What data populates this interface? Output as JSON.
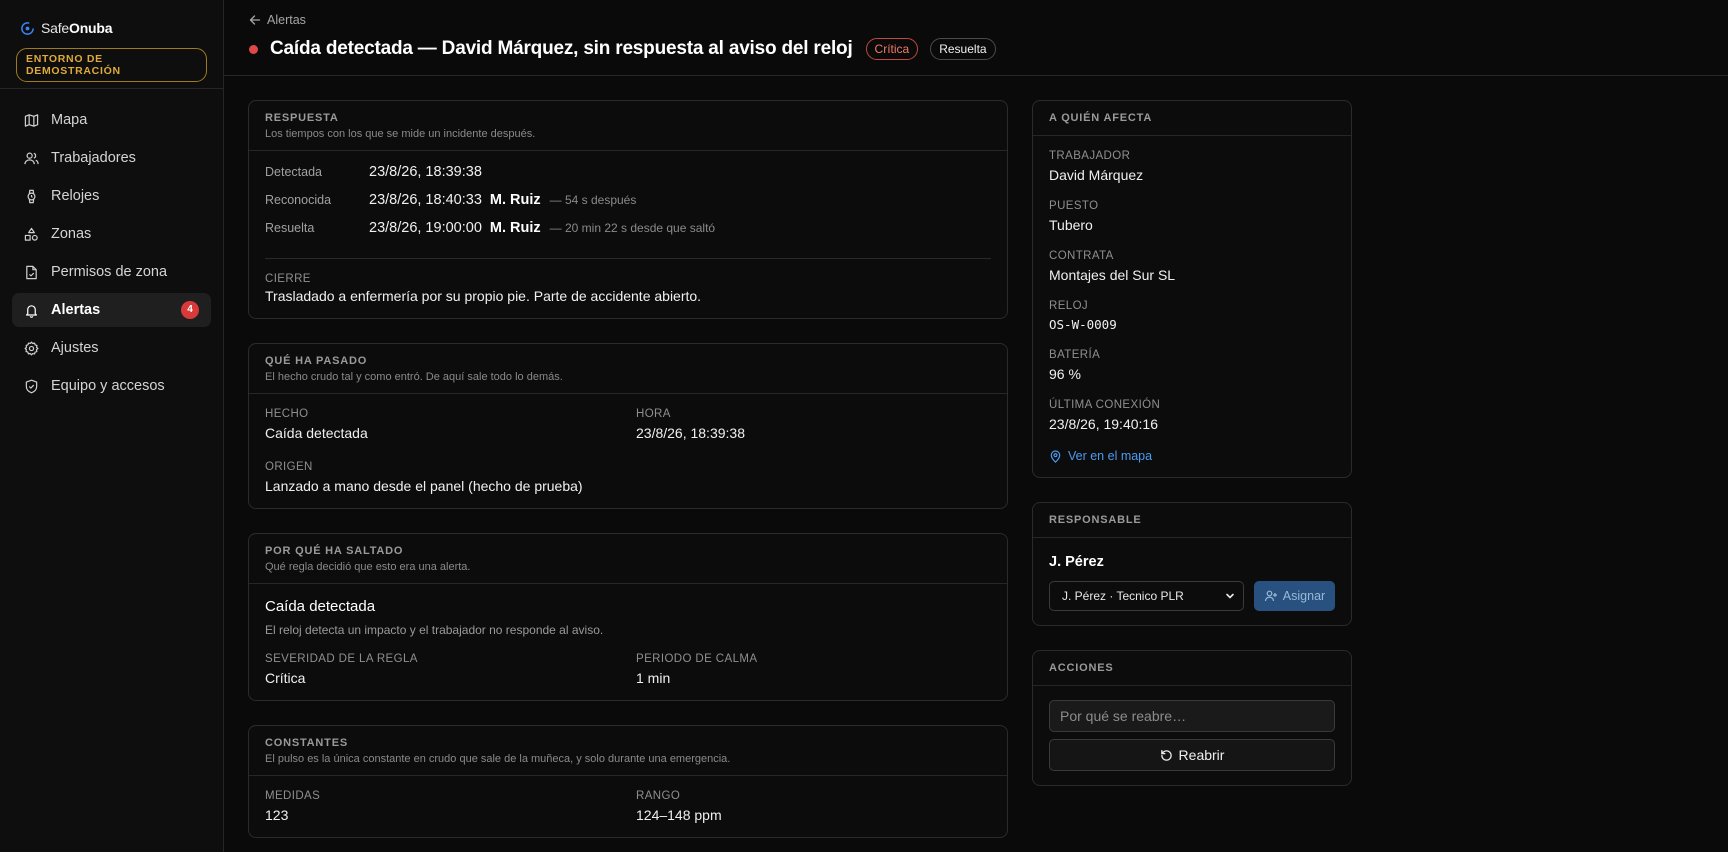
{
  "brand": {
    "name_light": "Safe",
    "name_bold": "Onuba",
    "env_badge": "ENTORNO DE DEMOSTRACIÓN",
    "accent": "#e0a93a"
  },
  "sidebar": {
    "items": [
      {
        "label": "Mapa",
        "icon": "map-icon"
      },
      {
        "label": "Trabajadores",
        "icon": "users-icon"
      },
      {
        "label": "Relojes",
        "icon": "watch-icon"
      },
      {
        "label": "Zonas",
        "icon": "shapes-icon"
      },
      {
        "label": "Permisos de zona",
        "icon": "file-check-icon"
      },
      {
        "label": "Alertas",
        "icon": "bell-icon",
        "badge": "4",
        "active": true
      },
      {
        "label": "Ajustes",
        "icon": "gear-icon"
      },
      {
        "label": "Equipo y accesos",
        "icon": "shield-check-icon"
      }
    ]
  },
  "header": {
    "back_label": "Alertas",
    "title": "Caída detectada — David Márquez, sin respuesta al aviso del reloj",
    "severity_pill": "Crítica",
    "status_pill": "Resuelta",
    "severity_color": "#e04848"
  },
  "respuesta": {
    "title": "RESPUESTA",
    "subtitle": "Los tiempos con los que se mide un incidente después.",
    "rows": [
      {
        "label": "Detectada",
        "time": "23/8/26, 18:39:38",
        "who": "",
        "note": ""
      },
      {
        "label": "Reconocida",
        "time": "23/8/26, 18:40:33",
        "who": "M. Ruiz",
        "note": "— 54 s después"
      },
      {
        "label": "Resuelta",
        "time": "23/8/26, 19:00:00",
        "who": "M. Ruiz",
        "note": "— 20 min 22 s desde que saltó"
      }
    ],
    "cierre_label": "CIERRE",
    "cierre_text": "Trasladado a enfermería por su propio pie. Parte de accidente abierto."
  },
  "que_ha_pasado": {
    "title": "QUÉ HA PASADO",
    "subtitle": "El hecho crudo tal y como entró. De aquí sale todo lo demás.",
    "hecho_label": "HECHO",
    "hecho_value": "Caída detectada",
    "hora_label": "HORA",
    "hora_value": "23/8/26, 18:39:38",
    "origen_label": "ORIGEN",
    "origen_value": "Lanzado a mano desde el panel (hecho de prueba)"
  },
  "por_que": {
    "title": "POR QUÉ HA SALTADO",
    "subtitle": "Qué regla decidió que esto era una alerta.",
    "rule_name": "Caída detectada",
    "rule_desc": "El reloj detecta un impacto y el trabajador no responde al aviso.",
    "severidad_label": "SEVERIDAD DE LA REGLA",
    "severidad_value": "Crítica",
    "calma_label": "PERIODO DE CALMA",
    "calma_value": "1 min"
  },
  "constantes": {
    "title": "CONSTANTES",
    "subtitle": "El pulso es la única constante en crudo que sale de la muñeca, y solo durante una emergencia.",
    "medidas_label": "MEDIDAS",
    "medidas_value": "123",
    "rango_label": "RANGO",
    "rango_value": "124–148 ppm"
  },
  "afecta": {
    "title": "A QUIÉN AFECTA",
    "fields": [
      {
        "label": "TRABAJADOR",
        "value": "David Márquez"
      },
      {
        "label": "PUESTO",
        "value": "Tubero"
      },
      {
        "label": "CONTRATA",
        "value": "Montajes del Sur SL"
      },
      {
        "label": "RELOJ",
        "value": "OS-W-0009"
      },
      {
        "label": "BATERÍA",
        "value": "96 %"
      },
      {
        "label": "ÚLTIMA CONEXIÓN",
        "value": "23/8/26, 19:40:16"
      }
    ],
    "map_link": "Ver en el mapa",
    "link_color": "#4d9af0"
  },
  "responsable": {
    "title": "RESPONSABLE",
    "name": "J. Pérez",
    "select_value": "J. Pérez · Tecnico PLR",
    "assign_label": "Asignar"
  },
  "acciones": {
    "title": "ACCIONES",
    "reopen_placeholder": "Por qué se reabre…",
    "reopen_label": "Reabrir"
  }
}
